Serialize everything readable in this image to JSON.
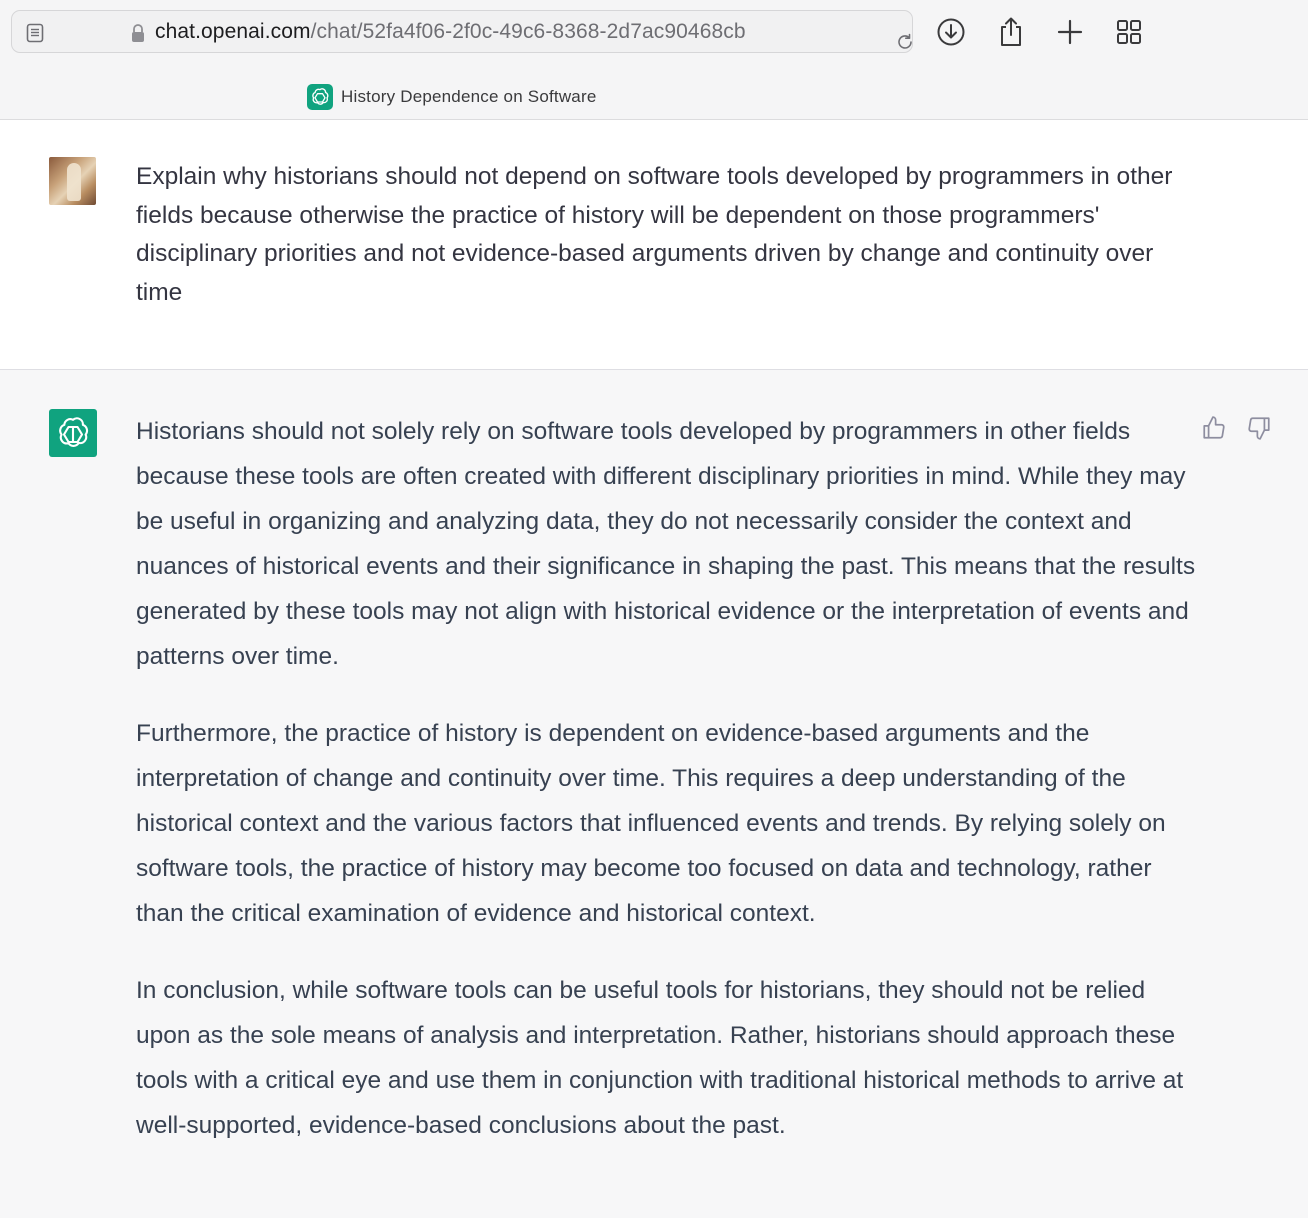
{
  "browser": {
    "url_host": "chat.openai.com",
    "url_path": "/chat/52fa4f06-2f0c-49c6-8368-2d7ac90468cb",
    "icons": [
      "reader-icon",
      "lock-icon",
      "reload-icon",
      "download-icon",
      "share-icon",
      "new-tab-icon",
      "tab-overview-icon"
    ]
  },
  "tab": {
    "title": "History Dependence on Software",
    "favicon": "openai-logo-icon",
    "accent_color": "#10a37f"
  },
  "conversation": {
    "user_message": "Explain why historians should not depend on software tools developed by programmers in other fields because otherwise the practice of history will be dependent on those programmers' disciplinary priorities and not evidence-based arguments driven by change and continuity over time",
    "assistant_paragraphs": [
      "Historians should not solely rely on software tools developed by programmers in other fields because these tools are often created with different disciplinary priorities in mind. While they may be useful in organizing and analyzing data, they do not necessarily consider the context and nuances of historical events and their significance in shaping the past. This means that the results generated by these tools may not align with historical evidence or the interpretation of events and patterns over time.",
      "Furthermore, the practice of history is dependent on evidence-based arguments and the interpretation of change and continuity over time. This requires a deep understanding of the historical context and the various factors that influenced events and trends. By relying solely on software tools, the practice of history may become too focused on data and technology, rather than the critical examination of evidence and historical context.",
      "In conclusion, while software tools can be useful tools for historians, they should not be relied upon as the sole means of analysis and interpretation. Rather, historians should approach these tools with a critical eye and use them in conjunction with traditional historical methods to arrive at well-supported, evidence-based conclusions about the past."
    ],
    "feedback_icons": [
      "thumbs-up-icon",
      "thumbs-down-icon"
    ]
  }
}
